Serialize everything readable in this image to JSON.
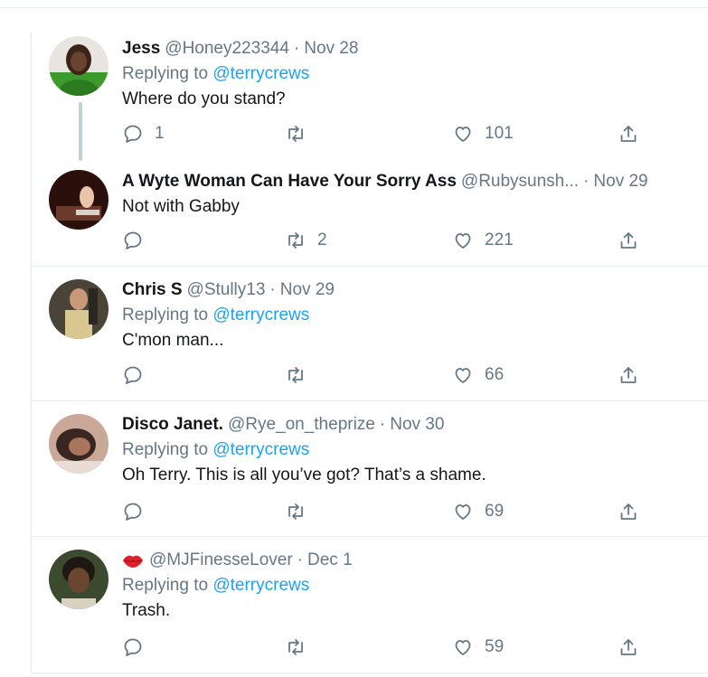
{
  "tweets": [
    {
      "name": "Jess",
      "handle": "@Honey223344",
      "date": "Nov 28",
      "replying_prefix": "Replying to",
      "replying_to": "@terrycrews",
      "text": "Where do you stand?",
      "replies": "1",
      "retweets": "",
      "likes": "101"
    },
    {
      "name": "A Wyte Woman Can Have Your Sorry Ass",
      "handle": "@Rubysunsh...",
      "date": "Nov 29",
      "text": "Not with Gabby",
      "replies": "",
      "retweets": "2",
      "likes": "221"
    },
    {
      "name": "Chris S",
      "handle": "@Stully13",
      "date": "Nov 29",
      "replying_prefix": "Replying to",
      "replying_to": "@terrycrews",
      "text": "C'mon man...",
      "replies": "",
      "retweets": "",
      "likes": "66"
    },
    {
      "name": "Disco Janet.",
      "handle": "@Rye_on_theprize",
      "date": "Nov 30",
      "replying_prefix": "Replying to",
      "replying_to": "@terrycrews",
      "text": "Oh Terry. This is all you’ve got? That’s a shame.",
      "replies": "",
      "retweets": "",
      "likes": "69"
    },
    {
      "name_icon": "lips-emoji-icon",
      "handle": "@MJFinesseLover",
      "date": "Dec 1",
      "replying_prefix": "Replying to",
      "replying_to": "@terrycrews",
      "text": "Trash.",
      "replies": "",
      "retweets": "",
      "likes": "59"
    }
  ],
  "colors": {
    "link": "#1da1f2",
    "secondary_text": "#657786",
    "primary_text": "#14171a",
    "divider": "#e6ecf0",
    "thread_line": "#c4cfd6"
  }
}
